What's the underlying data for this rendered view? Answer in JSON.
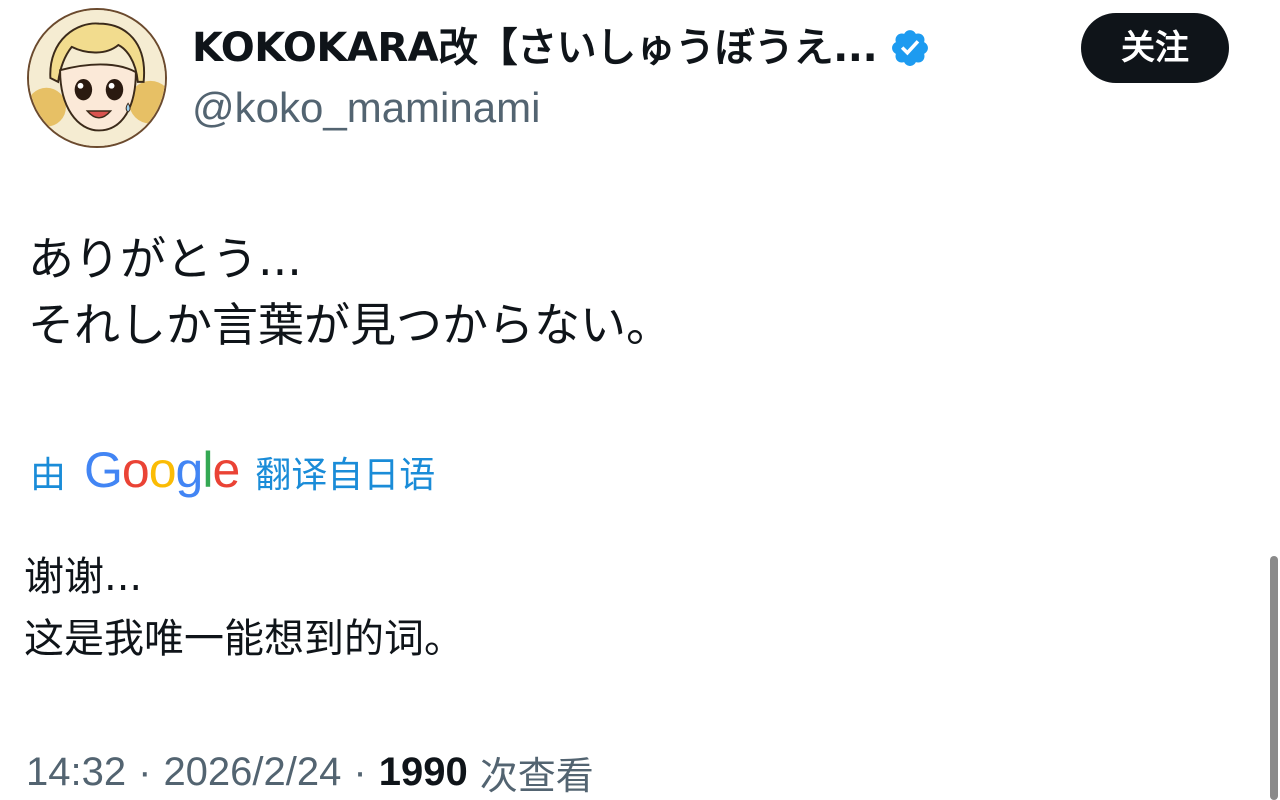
{
  "author": {
    "display_name": "KOKOKARA改【さいしゅうぼうえ...",
    "handle": "@koko_maminami",
    "avatar_icon": "anime-avatar-icon",
    "verified_icon": "verified-badge-icon",
    "verified_color": "#1d9bf0"
  },
  "actions": {
    "follow_label": "关注"
  },
  "tweet": {
    "lines": [
      "ありがとう...",
      "それしか言葉が見つからない。"
    ]
  },
  "translation": {
    "prefix": "由",
    "provider": "Google",
    "suffix": "翻译自日语",
    "link_color": "#1a8cd8",
    "lines": [
      "谢谢...",
      "这是我唯一能想到的词。"
    ]
  },
  "meta": {
    "time": "14:32",
    "separator": "·",
    "date": "2026/2/24",
    "views_count": "1990",
    "views_label": "次查看"
  }
}
